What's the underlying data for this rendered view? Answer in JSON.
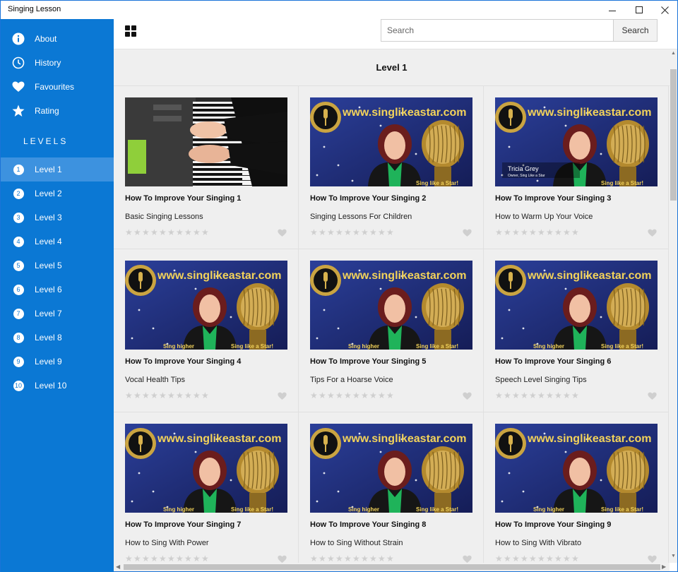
{
  "window": {
    "title": "Singing Lesson"
  },
  "colors": {
    "sidebar": "#0b78d4",
    "sidebar_active": "#3d92df",
    "content_bg": "#efefef"
  },
  "sidebar": {
    "top_items": [
      {
        "label": "About",
        "icon": "info-icon"
      },
      {
        "label": "History",
        "icon": "clock-icon"
      },
      {
        "label": "Favourites",
        "icon": "heart-icon"
      },
      {
        "label": "Rating",
        "icon": "star-icon"
      }
    ],
    "levels_heading": "LEVELS",
    "levels": [
      {
        "num": "1",
        "label": "Level 1",
        "active": true
      },
      {
        "num": "2",
        "label": "Level 2"
      },
      {
        "num": "3",
        "label": "Level 3"
      },
      {
        "num": "4",
        "label": "Level 4"
      },
      {
        "num": "5",
        "label": "Level 5"
      },
      {
        "num": "6",
        "label": "Level 6"
      },
      {
        "num": "7",
        "label": "Level 7"
      },
      {
        "num": "8",
        "label": "Level 8"
      },
      {
        "num": "9",
        "label": "Level 9"
      },
      {
        "num": "10",
        "label": "Level 10"
      }
    ]
  },
  "header": {
    "search_placeholder": "Search",
    "search_button": "Search"
  },
  "main": {
    "level_title": "Level 1",
    "lessons": [
      {
        "title": "How To Improve Your Singing 1",
        "subtitle": "Basic Singing Lessons",
        "thumb": "piano",
        "rating": 0
      },
      {
        "title": "How To Improve Your Singing 2",
        "subtitle": "Singing Lessons For Children",
        "thumb": "singlikeastar",
        "rating": 0
      },
      {
        "title": "How To Improve Your Singing 3",
        "subtitle": "How to Warm Up Your Voice",
        "thumb": "singlikeastar",
        "rating": 0,
        "caption_name": "Tricia Grey",
        "caption_role": "Owner, Sing Like a Star"
      },
      {
        "title": "How To Improve Your Singing 4",
        "subtitle": "Vocal Health Tips",
        "thumb": "singlikeastar",
        "rating": 0
      },
      {
        "title": "How To Improve Your Singing 5",
        "subtitle": "Tips For a Hoarse Voice",
        "thumb": "singlikeastar",
        "rating": 0
      },
      {
        "title": "How To Improve Your Singing 6",
        "subtitle": "Speech Level Singing Tips",
        "thumb": "singlikeastar",
        "rating": 0
      },
      {
        "title": "How To Improve Your Singing 7",
        "subtitle": "How to Sing With Power",
        "thumb": "singlikeastar",
        "rating": 0
      },
      {
        "title": "How To Improve Your Singing 8",
        "subtitle": "How to Sing Without Strain",
        "thumb": "singlikeastar",
        "rating": 0
      },
      {
        "title": "How To Improve Your Singing 9",
        "subtitle": "How to Sing With Vibrato",
        "thumb": "singlikeastar",
        "rating": 0
      }
    ],
    "thumb_banner_text": "www.singlikeastar.com",
    "thumb_slogan": "Sing higher... Sing like a Star!"
  }
}
